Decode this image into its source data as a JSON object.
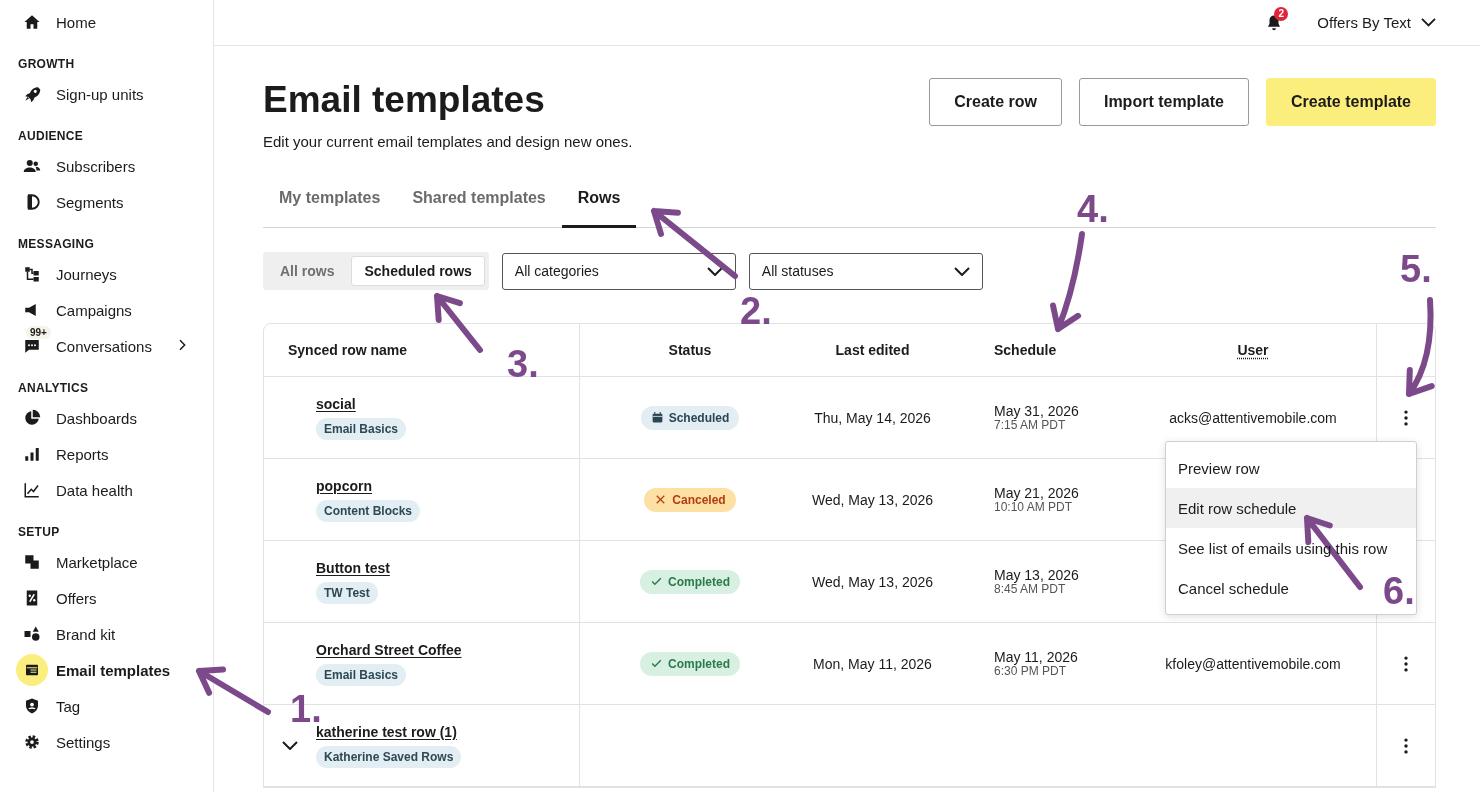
{
  "top_bar": {
    "notification_count": "2",
    "account": "Offers By Text"
  },
  "sidebar": [
    {
      "items": [
        {
          "label": "Home",
          "selected": false,
          "submenu": false
        }
      ]
    },
    {
      "title": "GROWTH",
      "items": [
        {
          "label": "Sign-up units",
          "selected": false,
          "submenu": false
        }
      ]
    },
    {
      "title": "AUDIENCE",
      "items": [
        {
          "label": "Subscribers",
          "selected": false,
          "submenu": false
        },
        {
          "label": "Segments",
          "selected": false,
          "submenu": false
        }
      ]
    },
    {
      "title": "MESSAGING",
      "items": [
        {
          "label": "Journeys",
          "selected": false,
          "submenu": false
        },
        {
          "label": "Campaigns",
          "selected": false,
          "submenu": false
        },
        {
          "label": "Conversations",
          "selected": false,
          "submenu": true,
          "badge": "99+"
        }
      ]
    },
    {
      "title": "ANALYTICS",
      "items": [
        {
          "label": "Dashboards",
          "selected": false,
          "submenu": false
        },
        {
          "label": "Reports",
          "selected": false,
          "submenu": false
        },
        {
          "label": "Data health",
          "selected": false,
          "submenu": false
        }
      ]
    },
    {
      "title": "SETUP",
      "items": [
        {
          "label": "Marketplace",
          "selected": false,
          "submenu": false
        },
        {
          "label": "Offers",
          "selected": false,
          "submenu": false
        },
        {
          "label": "Brand kit",
          "selected": false,
          "submenu": false
        },
        {
          "label": "Email templates",
          "selected": true,
          "submenu": false
        },
        {
          "label": "Tag",
          "selected": false,
          "submenu": false
        },
        {
          "label": "Settings",
          "selected": false,
          "submenu": false
        }
      ]
    }
  ],
  "page": {
    "title": "Email templates",
    "subtitle": "Edit your current email templates and design new ones.",
    "actions": [
      {
        "label": "Create row",
        "kind": "secondary"
      },
      {
        "label": "Import template",
        "kind": "secondary"
      },
      {
        "label": "Create template",
        "kind": "primary"
      }
    ]
  },
  "tabs": [
    {
      "label": "My templates",
      "selected": false
    },
    {
      "label": "Shared templates",
      "selected": false
    },
    {
      "label": "Rows",
      "selected": true
    }
  ],
  "view_toggle": [
    {
      "label": "All rows",
      "selected": false
    },
    {
      "label": "Scheduled rows",
      "selected": true
    }
  ],
  "filters": [
    {
      "value": "All categories"
    },
    {
      "value": "All statuses"
    }
  ],
  "table": {
    "columns": [
      "Synced row name",
      "Status",
      "Last edited",
      "Schedule",
      "User"
    ],
    "rows": [
      {
        "name": "social",
        "category": "Email Basics",
        "expandable": false,
        "status": {
          "label": "Scheduled",
          "kind": "scheduled"
        },
        "last_edited": "Thu, May 14, 2026",
        "schedule_date": "May 31, 2026",
        "schedule_time": "7:15 AM PDT",
        "user": "acks@attentivemobile.com",
        "more_button": true
      },
      {
        "name": "popcorn",
        "category": "Content Blocks",
        "expandable": false,
        "status": {
          "label": "Canceled",
          "kind": "canceled"
        },
        "last_edited": "Wed, May 13, 2026",
        "schedule_date": "May 21, 2026",
        "schedule_time": "10:10 AM PDT",
        "more_button": false
      },
      {
        "name": "Button test",
        "category": "TW Test",
        "expandable": false,
        "status": {
          "label": "Completed",
          "kind": "completed"
        },
        "last_edited": "Wed, May 13, 2026",
        "schedule_date": "May 13, 2026",
        "schedule_time": "8:45 AM PDT",
        "more_button": false
      },
      {
        "name": "Orchard Street Coffee",
        "category": "Email Basics",
        "expandable": false,
        "status": {
          "label": "Completed",
          "kind": "completed"
        },
        "last_edited": "Mon, May 11, 2026",
        "schedule_date": "May 11, 2026",
        "schedule_time": "6:30 PM PDT",
        "user": "kfoley@attentivemobile.com",
        "more_button": true
      },
      {
        "name": "katherine test row (1)",
        "category": "Katherine Saved Rows",
        "expandable": true,
        "more_button": true
      }
    ]
  },
  "row_menu": {
    "items": [
      {
        "label": "Preview row",
        "highlighted": false
      },
      {
        "label": "Edit row schedule",
        "highlighted": true
      },
      {
        "label": "See list of emails using this row",
        "highlighted": false
      },
      {
        "label": "Cancel schedule",
        "highlighted": false
      }
    ]
  },
  "annotations": [
    {
      "label": "1."
    },
    {
      "label": "2."
    },
    {
      "label": "3."
    },
    {
      "label": "4."
    },
    {
      "label": "5."
    },
    {
      "label": "6."
    }
  ]
}
